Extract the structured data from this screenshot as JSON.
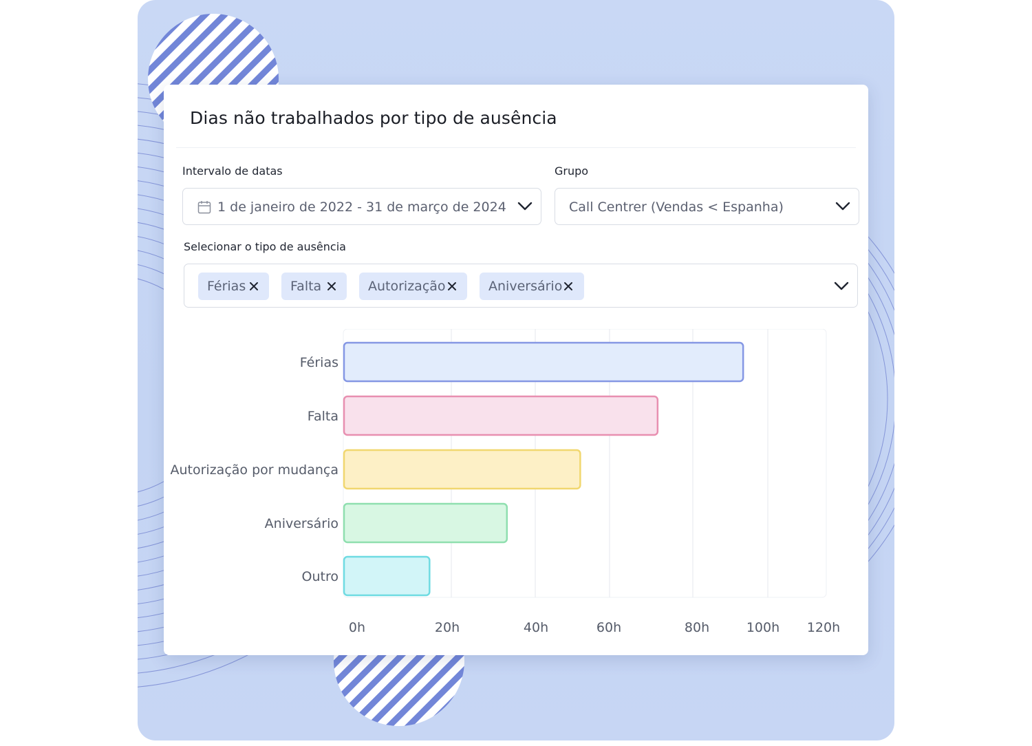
{
  "title": "Dias não trabalhados por tipo de ausência",
  "filters": {
    "date_range_label": "Intervalo de datas",
    "date_range_value": "1 de janeiro de 2022 - 31 de março de 2024",
    "group_label": "Grupo",
    "group_value": "Call Centrer (Vendas < Espanha)",
    "absence_type_label": "Selecionar o tipo de ausência",
    "chips": [
      "Férias",
      "Falta",
      "Autorização",
      "Aniversário"
    ]
  },
  "icons": {
    "date": "calendar-icon",
    "dropdown": "chevron-down-icon",
    "remove_chip": "close-icon"
  },
  "chart_data": {
    "type": "bar",
    "orientation": "horizontal",
    "title": "",
    "xlabel": "",
    "ylabel": "",
    "categories": [
      "Férias",
      "Falta",
      "Autorização por mudança",
      "Aniversário",
      "Outro"
    ],
    "values": [
      98,
      77,
      58,
      40,
      21
    ],
    "unit": "h",
    "xlim": [
      0,
      120
    ],
    "xticks": [
      "0h",
      "20h",
      "40h",
      "60h",
      "80h",
      "100h",
      "120h"
    ],
    "grid": true,
    "legend": "none",
    "colors": [
      {
        "fill": "#e2ecfc",
        "stroke": "#8597e4"
      },
      {
        "fill": "#f9e1ec",
        "stroke": "#e88fb0"
      },
      {
        "fill": "#fdf0c6",
        "stroke": "#f1d76f"
      },
      {
        "fill": "#d8f7e3",
        "stroke": "#8fdfaf"
      },
      {
        "fill": "#d2f5f8",
        "stroke": "#6fdbe2"
      }
    ]
  }
}
